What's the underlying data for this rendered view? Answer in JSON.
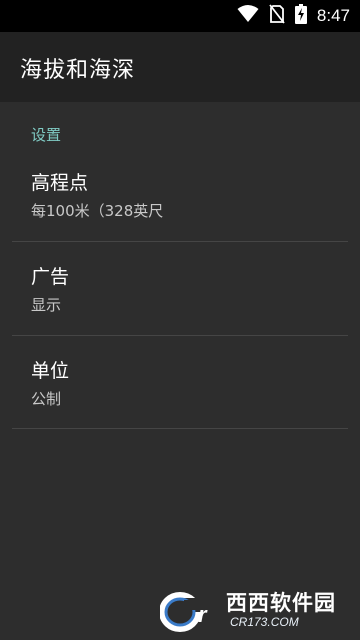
{
  "status_bar": {
    "time": "8:47",
    "icons": [
      "wifi-icon",
      "no-sim-icon",
      "battery-charging-icon"
    ]
  },
  "app_bar": {
    "title": "海拔和海深"
  },
  "settings": {
    "section_header": "设置",
    "items": [
      {
        "title": "高程点",
        "summary": "每100米（328英尺"
      },
      {
        "title": "广告",
        "summary": "显示"
      },
      {
        "title": "单位",
        "summary": "公制"
      }
    ]
  },
  "watermark": {
    "logo_text": "Cr",
    "name": "西西软件园",
    "url": "CR173.COM"
  },
  "colors": {
    "accent": "#80cbc4",
    "background": "#2d2d2d",
    "app_bar": "#222222",
    "status_bar": "#000000"
  }
}
